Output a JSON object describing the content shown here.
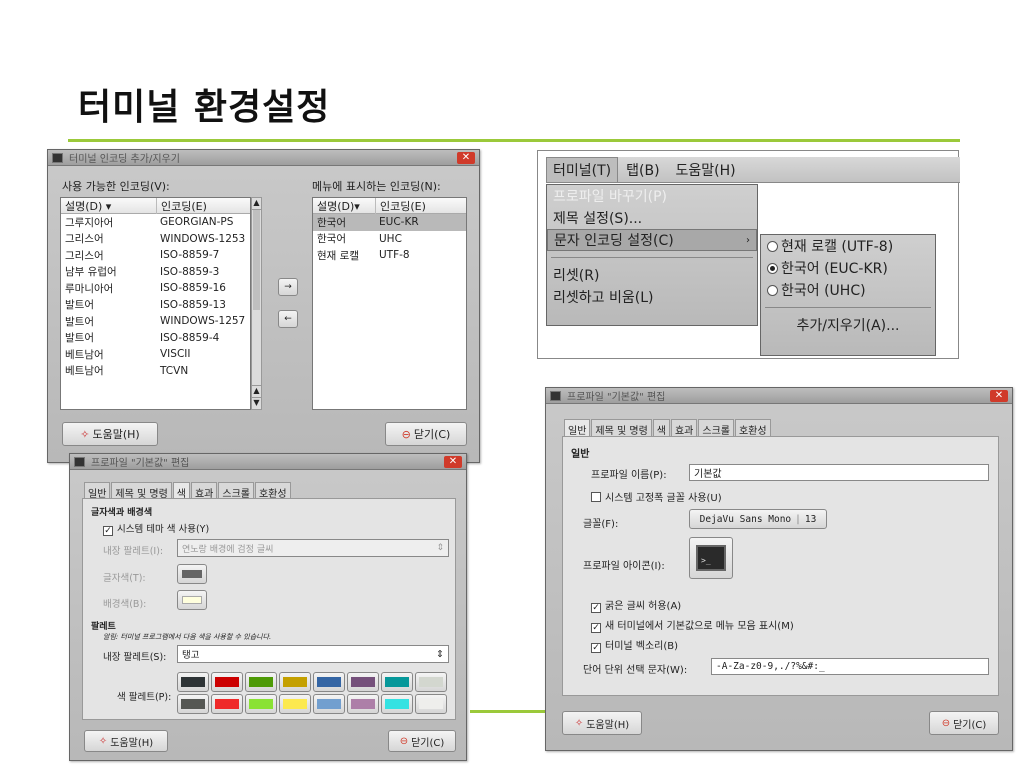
{
  "slide": {
    "title": "터미널 환경설정"
  },
  "encoding_dialog": {
    "title": "터미널 인코딩 추가/지우기",
    "available_label": "사용 가능한 인코딩(V):",
    "menu_label": "메뉴에 표시하는 인코딩(N):",
    "col_desc": "설명(D)",
    "col_enc": "인코딩(E)",
    "available": [
      {
        "desc": "그루지아어",
        "enc": "GEORGIAN-PS"
      },
      {
        "desc": "그리스어",
        "enc": "WINDOWS-1253"
      },
      {
        "desc": "그리스어",
        "enc": "ISO-8859-7"
      },
      {
        "desc": "남부 유럽어",
        "enc": "ISO-8859-3"
      },
      {
        "desc": "루마니아어",
        "enc": "ISO-8859-16"
      },
      {
        "desc": "발트어",
        "enc": "ISO-8859-13"
      },
      {
        "desc": "발트어",
        "enc": "WINDOWS-1257"
      },
      {
        "desc": "발트어",
        "enc": "ISO-8859-4"
      },
      {
        "desc": "베트남어",
        "enc": "VISCII"
      },
      {
        "desc": "베트남어",
        "enc": "TCVN"
      }
    ],
    "shown": [
      {
        "desc": "한국어",
        "enc": "EUC-KR"
      },
      {
        "desc": "한국어",
        "enc": "UHC"
      },
      {
        "desc": "현재 로캘",
        "enc": "UTF-8"
      }
    ],
    "add_arrow": "→",
    "remove_arrow": "←",
    "help": "도움말(H)",
    "close": "닫기(C)"
  },
  "menu_shot": {
    "menubar": [
      "터미널(T)",
      "탭(B)",
      "도움말(H)"
    ],
    "items": [
      "프로파일 바꾸기(P)",
      "제목 설정(S)...",
      "문자 인코딩 설정(C)",
      "리셋(R)",
      "리셋하고 비움(L)"
    ],
    "submenu": [
      "현재 로캘 (UTF-8)",
      "한국어 (EUC-KR)",
      "한국어 (UHC)"
    ],
    "submenu_extra": "추가/지우기(A)..."
  },
  "profile_color": {
    "title": "프로파일 \"기본값\" 편집",
    "tabs": [
      "일반",
      "제목 및 명령",
      "색",
      "효과",
      "스크롤",
      "호환성"
    ],
    "section1": "글자색과 배경색",
    "use_theme": "시스템 테마 색 사용(Y)",
    "builtin_label": "내장 팔레트(I):",
    "builtin_value": "연노랑 배경에 검정 글씨",
    "fg_label": "글자색(T):",
    "bg_label": "배경색(B):",
    "section2": "팔레트",
    "note": "알림: 터미널 프로그램에서 다음 색을 사용할 수 있습니다.",
    "palette_label": "내장 팔레트(S):",
    "palette_value": "탱고",
    "color_palette_label": "색 팔레트(P):",
    "swatches_top": [
      "#2e3436",
      "#cc0000",
      "#4e9a06",
      "#c4a000",
      "#3465a4",
      "#75507b",
      "#06989a",
      "#d3d7cf"
    ],
    "swatches_bottom": [
      "#555753",
      "#ef2929",
      "#8ae234",
      "#fce94f",
      "#729fcf",
      "#ad7fa8",
      "#34e2e2",
      "#eeeeec"
    ],
    "help": "도움말(H)",
    "close": "닫기(C)"
  },
  "profile_general": {
    "title": "프로파일 \"기본값\" 편집",
    "tabs": [
      "일반",
      "제목 및 명령",
      "색",
      "효과",
      "스크롤",
      "호환성"
    ],
    "section": "일반",
    "name_label": "프로파일 이름(P):",
    "name_value": "기본값",
    "sys_font": "시스템 고정폭 글꼴 사용(U)",
    "font_label": "글꼴(F):",
    "font_value": "DejaVu Sans Mono",
    "font_size": "13",
    "icon_label": "프로파일 아이콘(I):",
    "bold": "굵은 글씨 허용(A)",
    "menubar": "새 터미널에서 기본값으로 메뉴 모음 표시(M)",
    "bell": "터미널 벡소리(B)",
    "word_label": "단어 단위 선택 문자(W):",
    "word_value": "-A-Za-z0-9,./?%&#:_",
    "help": "도움말(H)",
    "close": "닫기(C)"
  }
}
